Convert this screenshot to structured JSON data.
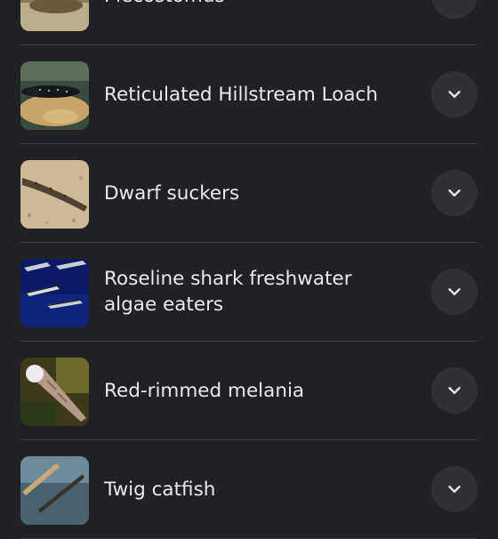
{
  "results": [
    {
      "title": "Plecostomus",
      "thumb": "plecostomus",
      "icon": "chevron-down-icon"
    },
    {
      "title": "Reticulated Hillstream Loach",
      "thumb": "hillstream-loach",
      "icon": "chevron-down-icon"
    },
    {
      "title": "Dwarf suckers",
      "thumb": "dwarf-sucker",
      "icon": "chevron-down-icon"
    },
    {
      "title": "Roseline shark freshwater algae eaters",
      "thumb": "roseline-shark",
      "icon": "chevron-down-icon"
    },
    {
      "title": "Red-rimmed melania",
      "thumb": "melania-snail",
      "icon": "chevron-down-icon"
    },
    {
      "title": "Twig catfish",
      "thumb": "twig-catfish",
      "icon": "chevron-down-icon"
    }
  ]
}
